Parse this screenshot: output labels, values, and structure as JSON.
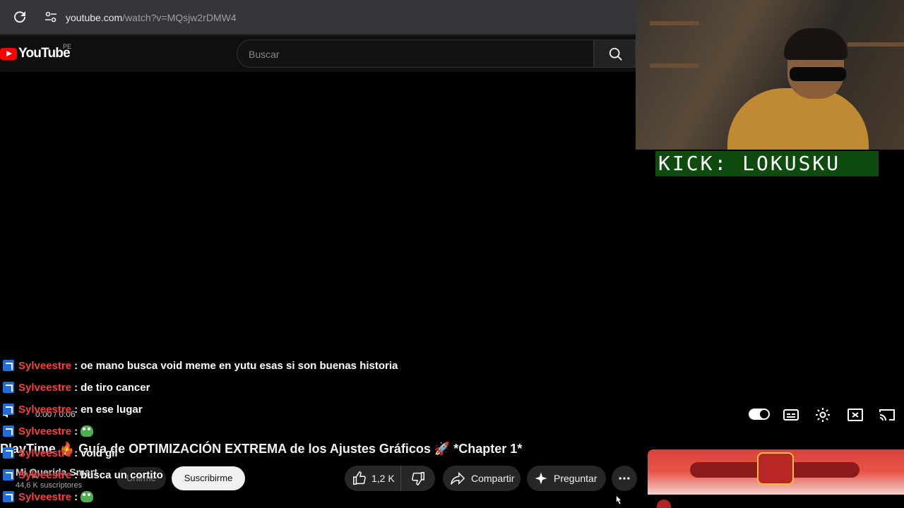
{
  "browser": {
    "url_host": "youtube.com",
    "url_path": "/watch?v=MQsjw2rDMW4"
  },
  "header": {
    "logo_text": "YouTube",
    "country_code": "PE",
    "search_placeholder": "Buscar"
  },
  "webcam": {
    "label": "KICK: LOKUSKU"
  },
  "chat": [
    {
      "user": "Sylveestre",
      "sep": ":",
      "message": "oe mano busca void meme en yutu esas si son buenas historia",
      "emoji": false
    },
    {
      "user": "Sylveestre",
      "sep": ":",
      "message": "de tiro cancer",
      "emoji": false
    },
    {
      "user": "Sylveestre",
      "sep": ":",
      "message": "en ese lugar",
      "emoji": false
    },
    {
      "user": "Sylveestre",
      "sep": ":",
      "message": "",
      "emoji": true
    },
    {
      "user": "Sylveestre",
      "sep": ":",
      "message": "void gil",
      "emoji": false
    },
    {
      "user": "Sylveestre",
      "sep": ":",
      "message": "busca un cortito",
      "emoji": false
    },
    {
      "user": "Sylveestre",
      "sep": ":",
      "message": "",
      "emoji": true
    }
  ],
  "player": {
    "time": "0:00 / 0:06"
  },
  "video": {
    "title": "PlayTime 🔥 Guía de OPTIMIZACIÓN EXTREMA de los Ajustes Gráficos 🚀 *Chapter 1*",
    "channel": "Mi Querida Smart",
    "subscribers": "44,6 K suscriptores",
    "join_label": "Unirme",
    "subscribe_label": "Suscribirme",
    "likes": "1,2 K",
    "share_label": "Compartir",
    "ask_label": "Preguntar"
  },
  "icons": [
    "reload-icon",
    "site-info-icon",
    "search-icon",
    "autoplay-toggle",
    "subtitles-icon",
    "settings-gear-icon",
    "miniplayer-icon",
    "cast-icon",
    "like-icon",
    "dislike-icon",
    "share-icon",
    "sparkle-icon",
    "more-dots-icon"
  ]
}
